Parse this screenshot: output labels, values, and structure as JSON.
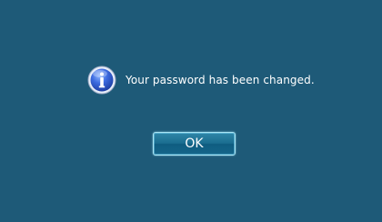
{
  "dialog": {
    "message": "Your password has been changed.",
    "icon": "info-icon",
    "ok_label": "OK"
  },
  "colors": {
    "background": "#1e5a78",
    "text": "#ffffff",
    "button_border": "#a8e4f4",
    "icon_fill": "#2a50c8"
  }
}
